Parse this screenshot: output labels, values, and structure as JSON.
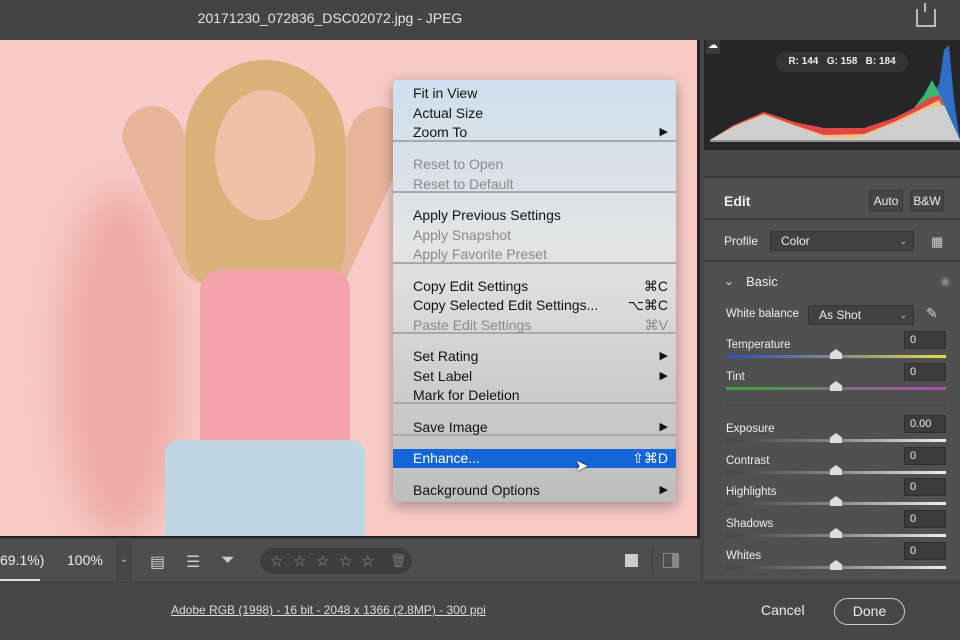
{
  "window": {
    "title": "20171230_072836_DSC02072.jpg  -  JPEG"
  },
  "histogram": {
    "r_label": "R:",
    "r": "144",
    "g_label": "G:",
    "g": "158",
    "b_label": "B:",
    "b": "184"
  },
  "edit": {
    "title": "Edit",
    "auto": "Auto",
    "bw": "B&W",
    "profile_label": "Profile",
    "profile_value": "Color"
  },
  "basic": {
    "title": "Basic",
    "wb_label": "White balance",
    "wb_value": "As Shot",
    "sliders": [
      {
        "label": "Temperature",
        "value": "0",
        "pos": 0.5
      },
      {
        "label": "Tint",
        "value": "0",
        "pos": 0.5
      },
      {
        "label": "Exposure",
        "value": "0.00",
        "pos": 0.5
      },
      {
        "label": "Contrast",
        "value": "0",
        "pos": 0.5
      },
      {
        "label": "Highlights",
        "value": "0",
        "pos": 0.5
      },
      {
        "label": "Shadows",
        "value": "0",
        "pos": 0.5
      },
      {
        "label": "Whites",
        "value": "0",
        "pos": 0.5
      }
    ]
  },
  "menu": {
    "items": [
      {
        "label": "Fit in View"
      },
      {
        "label": "Actual Size"
      },
      {
        "label": "Zoom To",
        "submenu": "▶"
      },
      {
        "label": "Reset to Open",
        "disabled": true
      },
      {
        "label": "Reset to Default",
        "disabled": true
      },
      {
        "label": "Apply Previous Settings"
      },
      {
        "label": "Apply Snapshot",
        "disabled": true
      },
      {
        "label": "Apply Favorite Preset",
        "disabled": true
      },
      {
        "label": "Copy Edit Settings",
        "shortcut": "⌘C"
      },
      {
        "label": "Copy Selected Edit Settings...",
        "shortcut": "⌥⌘C"
      },
      {
        "label": "Paste Edit Settings",
        "shortcut": "⌘V",
        "disabled": true
      },
      {
        "label": "Set Rating",
        "submenu": "▶"
      },
      {
        "label": "Set Label",
        "submenu": "▶"
      },
      {
        "label": "Mark for Deletion"
      },
      {
        "label": "Save Image",
        "submenu": "▶"
      },
      {
        "label": "Enhance...",
        "shortcut": "⇧⌘D",
        "highlighted": true
      },
      {
        "label": "Background Options",
        "submenu": "▶"
      }
    ]
  },
  "toolbar": {
    "fit_zoom": "69.1%)",
    "zoom": "100%",
    "stars": [
      "☆",
      "☆",
      "☆",
      "☆",
      "☆"
    ]
  },
  "footer": {
    "info": "Adobe RGB (1998) - 16 bit - 2048 x 1366 (2.8MP) - 300 ppi",
    "cancel": "Cancel",
    "done": "Done"
  }
}
